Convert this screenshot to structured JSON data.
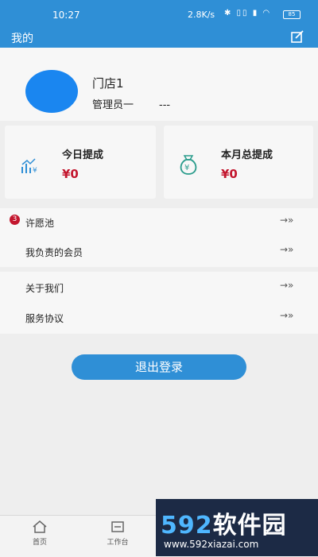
{
  "status_bar": {
    "time": "10:27",
    "network_speed": "2.8K/s",
    "battery": "85"
  },
  "header": {
    "title": "我的"
  },
  "profile": {
    "store_name": "门店1",
    "role": "管理员一",
    "extra": "---"
  },
  "stats": [
    {
      "label": "今日提成",
      "amount": "¥0",
      "icon": "chart-icon"
    },
    {
      "label": "本月总提成",
      "amount": "¥0",
      "icon": "money-bag-icon"
    }
  ],
  "menu": {
    "group1": [
      {
        "label": "许愿池",
        "badge": "3"
      },
      {
        "label": "我负责的会员"
      }
    ],
    "group2": [
      {
        "label": "关于我们"
      },
      {
        "label": "服务协议"
      }
    ],
    "arrow": "→»"
  },
  "logout_label": "退出登录",
  "bottom_nav": [
    {
      "label": "首页",
      "icon": "home-icon"
    },
    {
      "label": "工作台",
      "icon": "workbench-icon"
    }
  ],
  "watermark": {
    "num": "592",
    "text": "软件园",
    "url": "www.592xiazai.com"
  },
  "colors": {
    "primary": "#2f8fd6",
    "amount": "#c3162e",
    "avatar": "#1a86f0"
  }
}
